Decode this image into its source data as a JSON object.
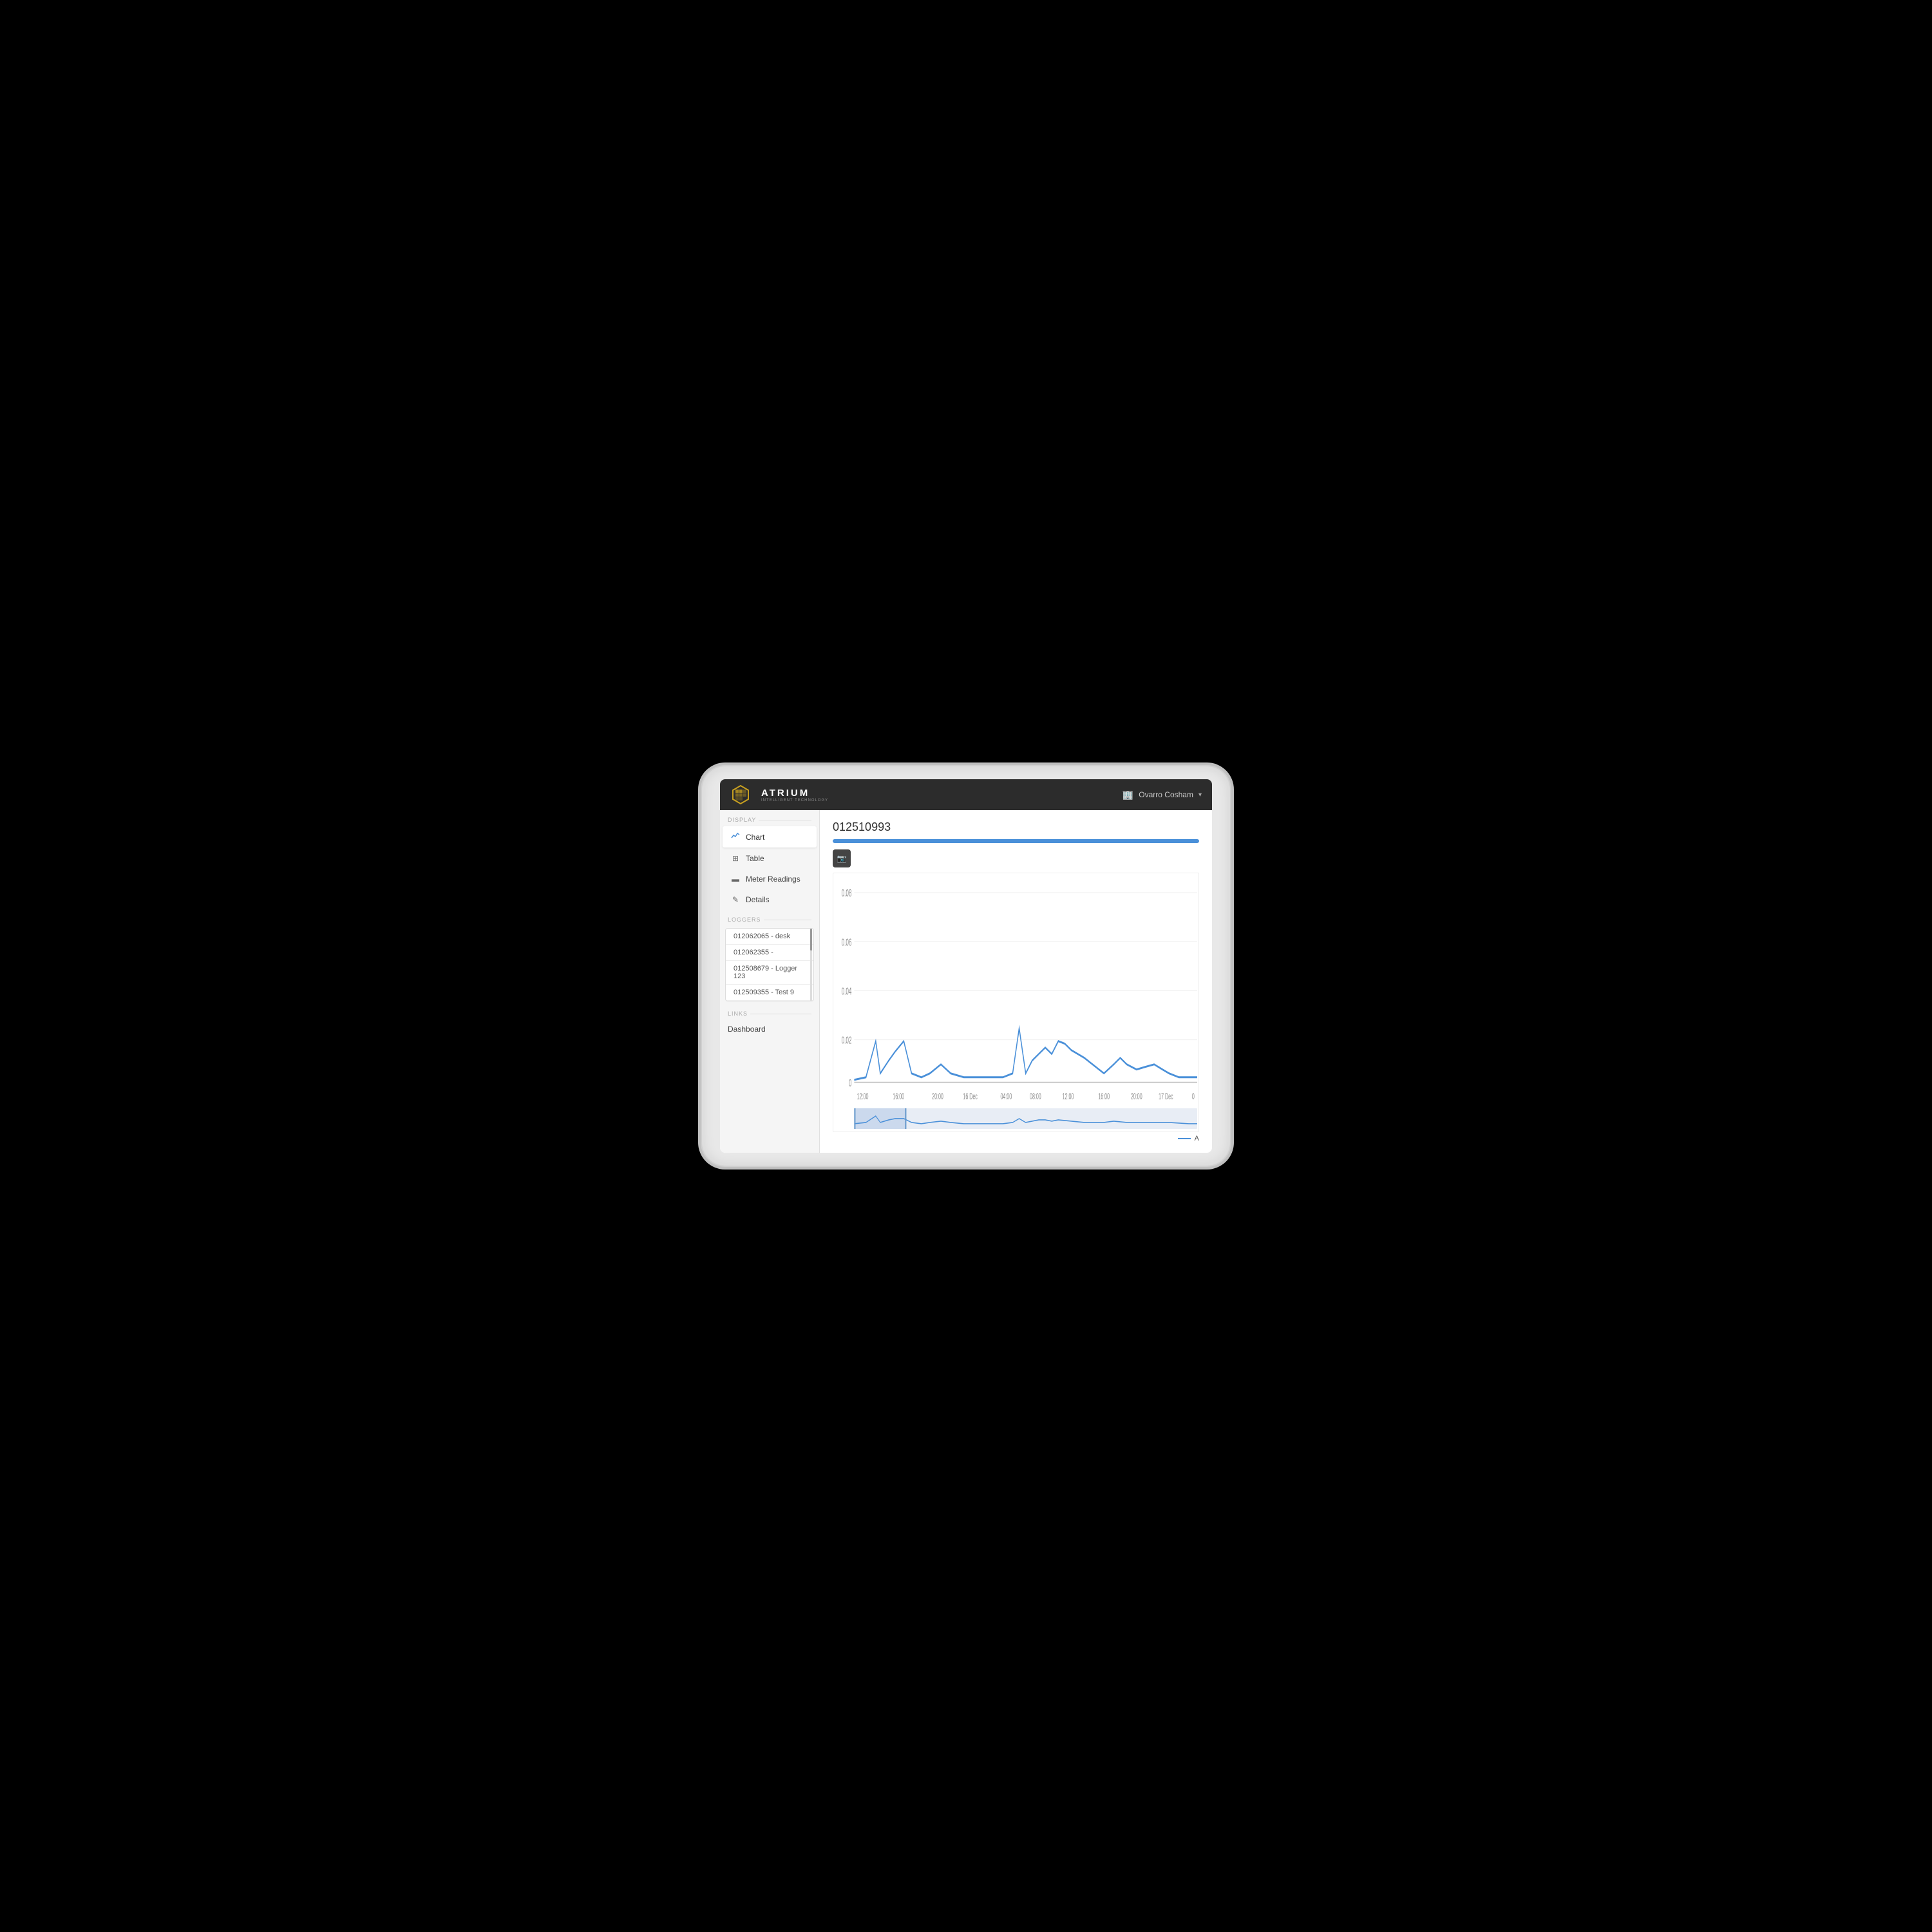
{
  "header": {
    "brand": "ATRIUM",
    "brand_subtitle": "INTELLIGENT TECHNOLOGY",
    "location": "Ovarro Cosham",
    "location_icon": "🏢"
  },
  "sidebar": {
    "display_label": "Display",
    "loggers_label": "Loggers",
    "links_label": "Links",
    "display_items": [
      {
        "id": "chart",
        "label": "Chart",
        "icon": "📈",
        "active": true
      },
      {
        "id": "table",
        "label": "Table",
        "icon": "⊞",
        "active": false
      },
      {
        "id": "meter-readings",
        "label": "Meter Readings",
        "icon": "📟",
        "active": false
      },
      {
        "id": "details",
        "label": "Details",
        "icon": "✏️",
        "active": false
      }
    ],
    "loggers": [
      {
        "id": "l1",
        "label": "012062065 - desk"
      },
      {
        "id": "l2",
        "label": "012062355 -"
      },
      {
        "id": "l3",
        "label": "012508679 - Logger 123"
      },
      {
        "id": "l4",
        "label": "012509355 - Test 9"
      }
    ],
    "links": [
      {
        "id": "dashboard",
        "label": "Dashboard"
      }
    ]
  },
  "main": {
    "title": "012510993",
    "toolbar": {
      "camera_icon_label": "📷"
    },
    "chart": {
      "y_labels": [
        "0.08",
        "0.06",
        "0.04",
        "0.02",
        "0"
      ],
      "x_labels": [
        "12:00",
        "16:00",
        "20:00",
        "16 Dec",
        "04:00",
        "08:00",
        "12:00",
        "16:00",
        "20:00",
        "17 Dec",
        "0"
      ],
      "legend_label": "A",
      "series_color": "#4a90d9"
    }
  }
}
